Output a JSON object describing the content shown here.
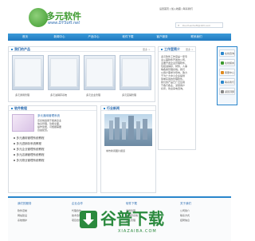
{
  "header": {
    "logo_text": "多元软件",
    "logo_url": "www.DYSoft.net",
    "top_links": "设置首页 | 加入收藏 | 联系我们",
    "search_placeholder": "DuoYuanSoft@163.com"
  },
  "nav": {
    "items": [
      "首页",
      "新闻中心",
      "产品中心",
      "软件下载",
      "客户服务",
      "联系我们"
    ]
  },
  "products": {
    "title": "我们的产品",
    "more": "更多 >",
    "captions": [
      "多元通用管理",
      "多元进销存系统",
      "多元企业管理",
      "多元店铺管理"
    ]
  },
  "about": {
    "title": "工作室简介",
    "more": "更多 >",
    "lines": [
      "多元软件工作室是一家专",
      "业从事软件开发的公司，",
      "主要开发企业管理软件，",
      "包括进销存、财务、人事",
      "等各类管理系统。我们",
      "以用户需求为导向，致力",
      "于为广大中小企业提供",
      "简单实用的管理软件。",
      "我们的产品已广泛应用",
      "于各行各业，深受用户",
      "好评。欢迎来电咨询。"
    ]
  },
  "bottom_tabs": [
    {
      "title": "软件教程",
      "text": "多元通用管理系统教程"
    },
    {
      "title": "行业新闻",
      "text": "行业最新动态报道"
    }
  ],
  "software": {
    "title": "多元通用管理系统",
    "desc_lines": [
      "该系统适用于各类企业",
      "信息管理，功能全面，",
      "操作简便，可根据需要",
      "自由配置。"
    ],
    "items": [
      "多元通用管理系统教程",
      "多元进销存系统教程",
      "多元企业管理系统教程",
      "多元店铺管理系统教程",
      "多元物业管理系统教程"
    ]
  },
  "news": {
    "caption": "城市新闻图片报道"
  },
  "sidebar_buttons": [
    "在线咨询",
    "在线留言",
    "客服中心",
    "联系我们",
    "返回顶部"
  ],
  "footer": {
    "columns": [
      {
        "title": "我们的服务",
        "items": [
          "软件定制",
          "网站建设",
          "系统维护"
        ]
      },
      {
        "title": "企业合作",
        "items": [
          "代理合作",
          "技术合作",
          "项目合作"
        ]
      },
      {
        "title": "软件下载",
        "items": [
          "通用管理",
          "进销存系统",
          "企业管理"
        ]
      },
      {
        "title": "关于我们",
        "items": [
          "公司简介",
          "联系方式",
          "招聘信息"
        ]
      }
    ],
    "watermark": "谷普下载",
    "watermark_sub": "XIAZAIBA.COM"
  },
  "colors": {
    "nav": "#2a86cc",
    "link": "#2a6bb0",
    "brand_green": "#3c9a2e"
  }
}
